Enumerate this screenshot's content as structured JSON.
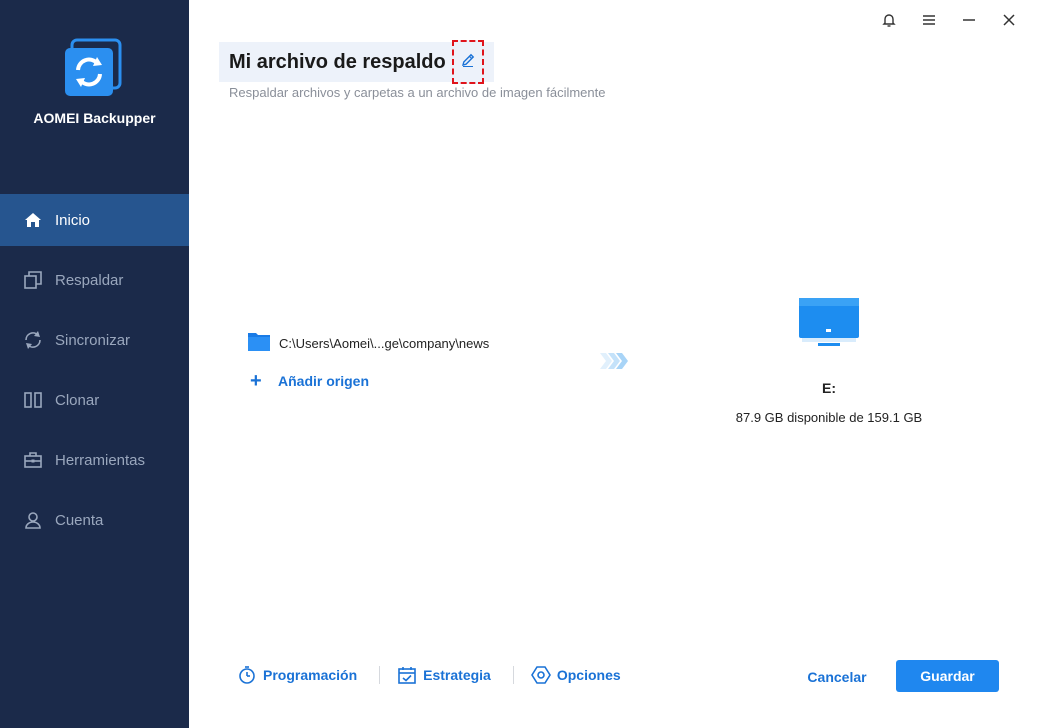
{
  "app": {
    "name": "AOMEI Backupper",
    "accent": "#1f87ef",
    "sidebar_bg": "#1b2a4a"
  },
  "sidebar": {
    "items": [
      {
        "label": "Inicio",
        "icon": "home-icon",
        "active": true
      },
      {
        "label": "Respaldar",
        "icon": "copy-icon"
      },
      {
        "label": "Sincronizar",
        "icon": "sync-icon"
      },
      {
        "label": "Clonar",
        "icon": "clone-icon"
      },
      {
        "label": "Herramientas",
        "icon": "toolbox-icon"
      },
      {
        "label": "Cuenta",
        "icon": "user-icon"
      }
    ]
  },
  "window_controls": [
    "bell-icon",
    "menu-icon",
    "minimize-icon",
    "close-icon"
  ],
  "header": {
    "title": "Mi archivo de respaldo",
    "subtitle": "Respaldar archivos y carpetas a un archivo de imagen fácilmente"
  },
  "source": {
    "path": "C:\\Users\\Aomei\\...ge\\company\\news",
    "add_label": "Añadir origen"
  },
  "destination": {
    "drive": "E:",
    "space": "87.9 GB disponible de 159.1 GB"
  },
  "bottom": {
    "schedule_label": "Programación",
    "strategy_label": "Estrategia",
    "options_label": "Opciones",
    "cancel_label": "Cancelar",
    "save_label": "Guardar"
  }
}
